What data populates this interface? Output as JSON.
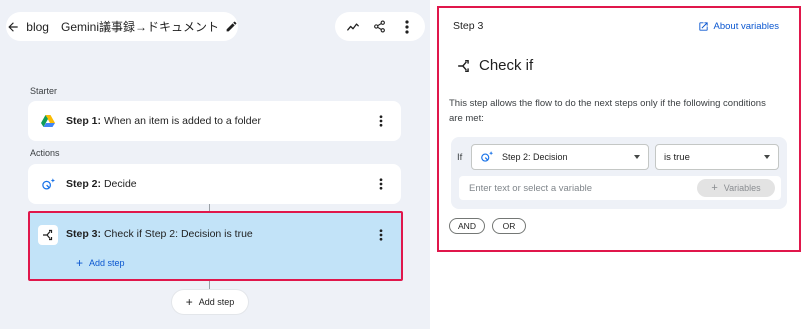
{
  "header": {
    "flow_title": "blog　Gemini議事録→ドキュメント",
    "back_icon": "back-arrow-icon",
    "edit_icon": "pencil-icon",
    "actions": {
      "activity_icon": "activity-icon",
      "share_icon": "share-icon",
      "more_icon": "more-vert-icon"
    }
  },
  "canvas": {
    "starter_label": "Starter",
    "actions_label": "Actions",
    "steps": [
      {
        "prefix": "Step 1:",
        "text": "When an item is added to a folder",
        "icon": "google-drive-icon"
      },
      {
        "prefix": "Step 2:",
        "text": "Decide",
        "icon": "gemini-decide-icon"
      },
      {
        "prefix": "Step 3:",
        "text": "Check if Step 2: Decision is true",
        "icon": "check-if-icon",
        "add_step_label": "Add step"
      }
    ],
    "add_step_label": "Add step"
  },
  "panel": {
    "step_label": "Step 3",
    "about_label": "About variables",
    "heading": "Check if",
    "description": "This step allows the flow to do the next steps only if the following conditions are met:",
    "condition": {
      "if_label": "If",
      "variable_value": "Step 2: Decision",
      "operator_value": "is true",
      "value_placeholder": "Enter text or select a variable",
      "variables_button": "Variables"
    },
    "and_label": "AND",
    "or_label": "OR"
  },
  "colors": {
    "highlight_border": "#e0174b",
    "selected_step_bg": "#c2e3f8",
    "link_blue": "#0b57d0",
    "canvas_bg": "#eef1f7"
  }
}
